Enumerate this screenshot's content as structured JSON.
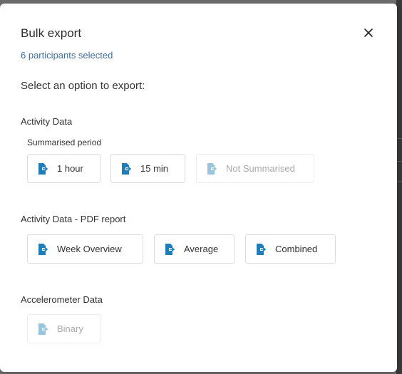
{
  "dialog": {
    "title": "Bulk export",
    "subtitle": "6 participants selected",
    "prompt": "Select an option to export:",
    "close_icon": "close-icon"
  },
  "sections": {
    "activity": {
      "title": "Activity Data",
      "sub_label": "Summarised period",
      "buttons": [
        {
          "label": "1 hour",
          "enabled": true
        },
        {
          "label": "15 min",
          "enabled": true
        },
        {
          "label": "Not Summarised",
          "enabled": false
        }
      ]
    },
    "pdf": {
      "title": "Activity Data - PDF report",
      "buttons": [
        {
          "label": "Week Overview",
          "enabled": true
        },
        {
          "label": "Average",
          "enabled": true
        },
        {
          "label": "Combined",
          "enabled": true
        }
      ]
    },
    "accelerometer": {
      "title": "Accelerometer Data",
      "buttons": [
        {
          "label": "Binary",
          "enabled": false
        }
      ]
    }
  },
  "colors": {
    "icon_blue": "#1f7db8",
    "subtitle_blue": "#3f6fa6",
    "disabled_text": "#a8a8a8"
  },
  "button_icon": "file-export-icon"
}
